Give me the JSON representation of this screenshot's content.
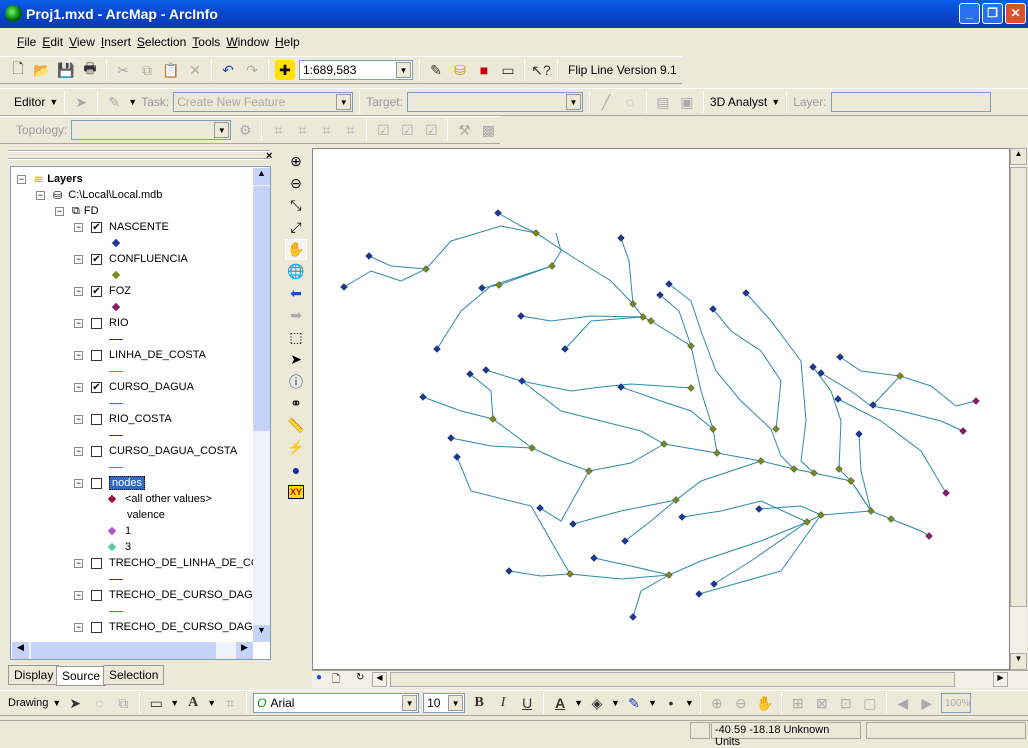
{
  "window": {
    "title": "Proj1.mxd - ArcMap - ArcInfo"
  },
  "menu": [
    "File",
    "Edit",
    "View",
    "Insert",
    "Selection",
    "Tools",
    "Window",
    "Help"
  ],
  "standard_toolbar": {
    "scale": "1:689,583",
    "flip_line": "Flip Line Version 9.1"
  },
  "editor_toolbar": {
    "editor": "Editor",
    "task_label": "Task:",
    "task_value": "Create New Feature",
    "target_label": "Target:",
    "analyst": "3D Analyst",
    "layer_label": "Layer:"
  },
  "topology_toolbar": {
    "label": "Topology:"
  },
  "toc": {
    "root": "Layers",
    "db": "C:\\Local\\Local.mdb",
    "dataset": "FD",
    "layers": [
      {
        "name": "NASCENTE",
        "checked": true,
        "symbol": "point",
        "color": "#1a3a9a"
      },
      {
        "name": "CONFLUENCIA",
        "checked": true,
        "symbol": "point",
        "color": "#7a8a20"
      },
      {
        "name": "FOZ",
        "checked": true,
        "symbol": "point",
        "color": "#8a1a6a"
      },
      {
        "name": "RIO",
        "checked": false,
        "symbol": "line",
        "color": "#2a2aa0"
      },
      {
        "name": "LINHA_DE_COSTA",
        "checked": false,
        "symbol": "line",
        "color": "#30c030"
      },
      {
        "name": "CURSO_DAGUA",
        "checked": true,
        "symbol": "line",
        "color": "#2a8aaa"
      },
      {
        "name": "RIO_COSTA",
        "checked": false,
        "symbol": "line",
        "color": "#5a2ab0"
      },
      {
        "name": "CURSO_DAGUA_COSTA",
        "checked": false,
        "symbol": "line",
        "color": "#2aa08a"
      }
    ],
    "nodes": {
      "name": "nodes",
      "checked": false,
      "other": "<all other values>",
      "other_color": "#a01040",
      "field": "valence",
      "classes": [
        {
          "label": "1",
          "color": "#b050d0"
        },
        {
          "label": "3",
          "color": "#50d0a0"
        }
      ]
    },
    "more_layers": [
      {
        "name": "TRECHO_DE_LINHA_DE_COST",
        "checked": false,
        "color": "#5a2ab0"
      },
      {
        "name": "TRECHO_DE_CURSO_DAGUA",
        "checked": false,
        "color": "#c06020"
      },
      {
        "name": "TRECHO_DE_CURSO_DAGUA_",
        "checked": false,
        "color": "#c020c0"
      }
    ],
    "tabs": [
      "Display",
      "Source",
      "Selection"
    ]
  },
  "drawing_toolbar": {
    "drawing": "Drawing",
    "font": "Arial",
    "size": "10",
    "bold": "B",
    "italic": "I",
    "underline": "U",
    "zoom": "100%"
  },
  "status": {
    "coords": "-40.59  -18.18 Unknown Units"
  },
  "colors": {
    "river": "#2a8aaa",
    "nascente": "#1a3a9a",
    "confluencia": "#7a8a20",
    "foz": "#8a1a6a"
  }
}
